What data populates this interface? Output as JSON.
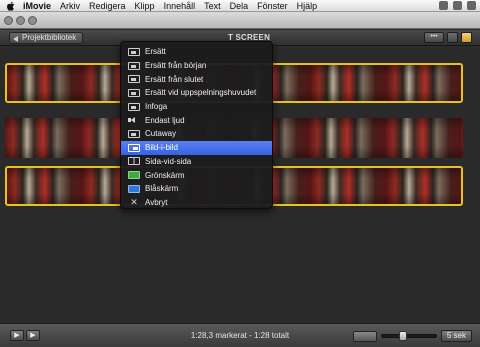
{
  "menubar": {
    "app": "iMovie",
    "items": [
      "Arkiv",
      "Redigera",
      "Klipp",
      "Innehåll",
      "Text",
      "Dela",
      "Fönster",
      "Hjälp"
    ]
  },
  "project_toolbar": {
    "library_button": "Projektbibliotek",
    "title": "T SCREEN",
    "dots_button": "•••"
  },
  "context_menu": {
    "items": [
      {
        "label": "Ersätt",
        "icon": "replace-icon"
      },
      {
        "label": "Ersätt från början",
        "icon": "replace-from-start-icon"
      },
      {
        "label": "Ersätt från slutet",
        "icon": "replace-from-end-icon"
      },
      {
        "label": "Ersätt vid uppspelningshuvudet",
        "icon": "replace-at-playhead-icon"
      },
      {
        "label": "Infoga",
        "icon": "insert-icon"
      },
      {
        "label": "Endast ljud",
        "icon": "speaker-icon"
      },
      {
        "label": "Cutaway",
        "icon": "cutaway-icon"
      },
      {
        "label": "Bild-i-bild",
        "icon": "picture-in-picture-icon",
        "highlighted": true
      },
      {
        "label": "Sida-vid-sida",
        "icon": "side-by-side-icon"
      },
      {
        "label": "Grönskärm",
        "icon": "green-screen-icon"
      },
      {
        "label": "Blåskärm",
        "icon": "blue-screen-icon"
      },
      {
        "label": "Avbryt",
        "icon": "cancel-x-icon"
      }
    ]
  },
  "bottombar": {
    "status": "1:28,3 markerat - 1:28 totalt",
    "duration_button": "5 sek",
    "zoom_level": 0.35
  }
}
